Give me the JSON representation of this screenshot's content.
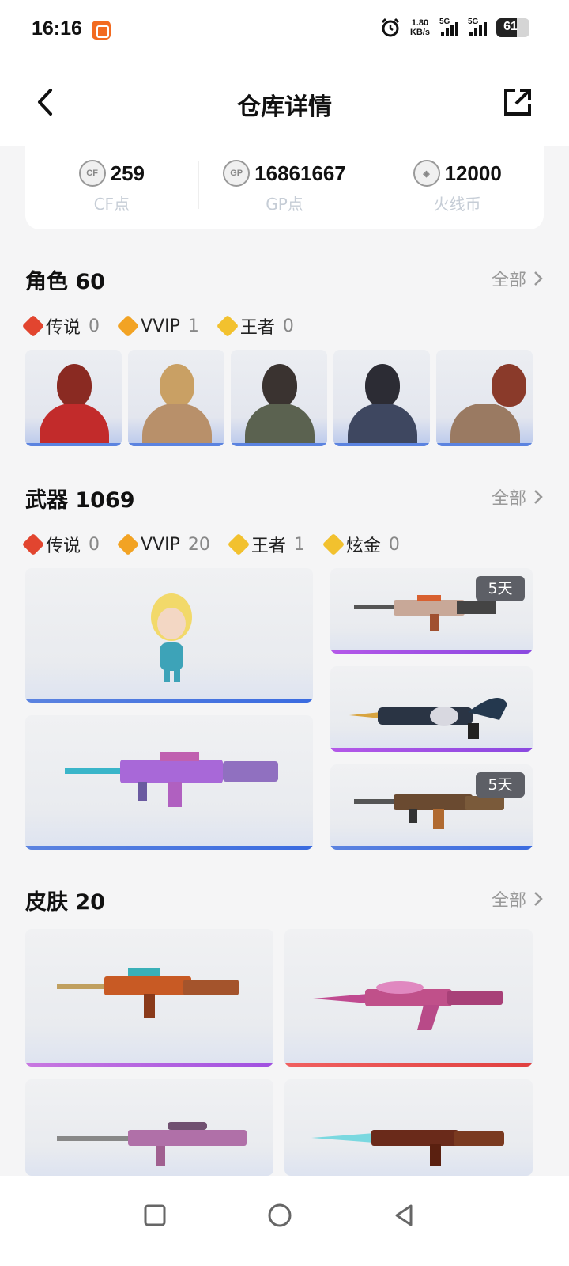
{
  "status": {
    "time": "16:16",
    "net_speed_value": "1.80",
    "net_speed_unit": "KB/s",
    "signal1": "5G",
    "signal2": "5G",
    "battery": "61",
    "battery_level": 0.61
  },
  "header": {
    "title": "仓库详情"
  },
  "currency": [
    {
      "icon": "cf-point-icon",
      "value": "259",
      "label": "CF点"
    },
    {
      "icon": "gp-point-icon",
      "value": "16861667",
      "label": "GP点"
    },
    {
      "icon": "fire-coin-icon",
      "value": "12000",
      "label": "火线币"
    }
  ],
  "roles": {
    "title": "角色 60",
    "see_all": "全部",
    "tags": [
      {
        "name": "传说",
        "count": "0",
        "color": "#e2452f"
      },
      {
        "name": "VVIP",
        "count": "1",
        "color": "#f2a324"
      },
      {
        "name": "王者",
        "count": "0",
        "color": "#f2c12e"
      }
    ]
  },
  "weapons": {
    "title": "武器 1069",
    "see_all": "全部",
    "tags": [
      {
        "name": "传说",
        "count": "0",
        "color": "#e2452f"
      },
      {
        "name": "VVIP",
        "count": "20",
        "color": "#f2a324"
      },
      {
        "name": "王者",
        "count": "1",
        "color": "#f2c12e"
      },
      {
        "name": "炫金",
        "count": "0",
        "color": "#f2c12e"
      }
    ],
    "badges": [
      "5天",
      "5天"
    ]
  },
  "skins": {
    "title": "皮肤 20",
    "see_all": "全部"
  }
}
